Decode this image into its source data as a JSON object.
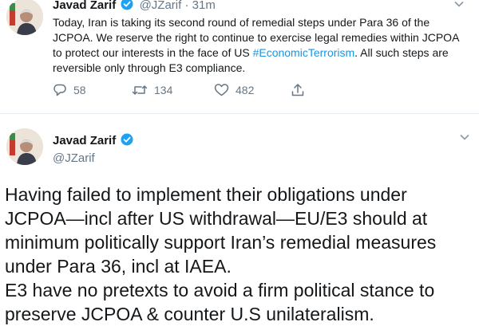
{
  "tweet1": {
    "author_name": "Javad Zarif",
    "handle": "@JZarif",
    "separator": "·",
    "time": "31m",
    "text_before_hashtag": "Today, Iran is taking its second round of remedial steps under Para 36 of the JCPOA. We reserve the right to continue to exercise legal remedies within JCPOA to protect our interests in the face of US ",
    "hashtag": "#EconomicTerrorism",
    "text_after_hashtag": ". All such steps are reversible only through E3 compliance.",
    "reply_count": "58",
    "retweet_count": "134",
    "like_count": "482"
  },
  "tweet2": {
    "author_name": "Javad Zarif",
    "handle": "@JZarif",
    "lines": [
      "Having failed to implement their obligations under",
      "JCPOA—incl after US withdrawal—EU/E3 should at",
      "minimum politically support Iran’s remedial measures",
      "under Para 36, incl at IAEA.",
      "E3 have no pretexts to avoid a firm political stance to",
      "preserve JCPOA & counter U.S unilateralism."
    ]
  },
  "colors": {
    "accent": "#1b95e0",
    "secondary_text": "#657786",
    "divider": "#e6ecf0"
  },
  "icons": [
    "avatar",
    "verified-badge-icon",
    "chevron-down-icon",
    "reply-icon",
    "retweet-icon",
    "like-icon",
    "share-icon"
  ]
}
